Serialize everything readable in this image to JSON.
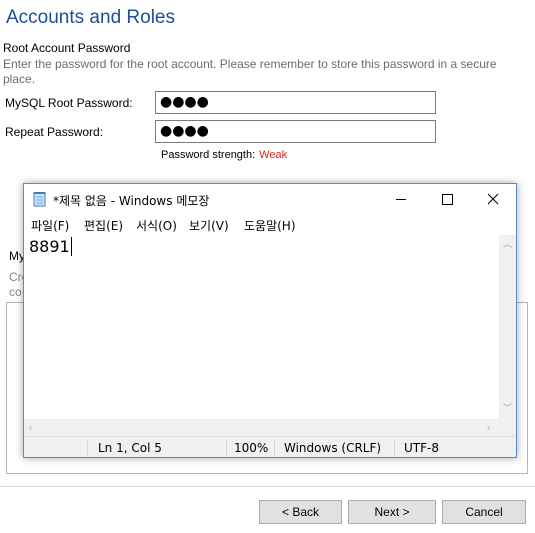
{
  "installer": {
    "title": "Accounts and Roles",
    "section_heading": "Root Account Password",
    "section_description": "Enter the password for the root account.  Please remember to store this password in a secure place.",
    "root_password_label": "MySQL Root Password:",
    "root_password_value": "●●●●",
    "repeat_password_label": "Repeat Password:",
    "repeat_password_value": "●●●●",
    "strength_label": "Password strength:",
    "strength_value": "Weak",
    "hidden_fragment_1": "My",
    "hidden_fragment_2": "Cre",
    "hidden_fragment_3": "co",
    "buttons": {
      "back": "< Back",
      "next": "Next >",
      "cancel": "Cancel"
    }
  },
  "notepad": {
    "title": "*제목 없음 - Windows 메모장",
    "menu": [
      "파일(F)",
      "편집(E)",
      "서식(O)",
      "보기(V)",
      "도움말(H)"
    ],
    "content": "8891",
    "status": {
      "position": "Ln 1, Col 5",
      "zoom": "100%",
      "line_ending": "Windows (CRLF)",
      "encoding": "UTF-8"
    }
  },
  "colors": {
    "title_blue": "#1f4e96",
    "weak_red": "#d02a1a",
    "window_border": "#5a8bc8"
  }
}
